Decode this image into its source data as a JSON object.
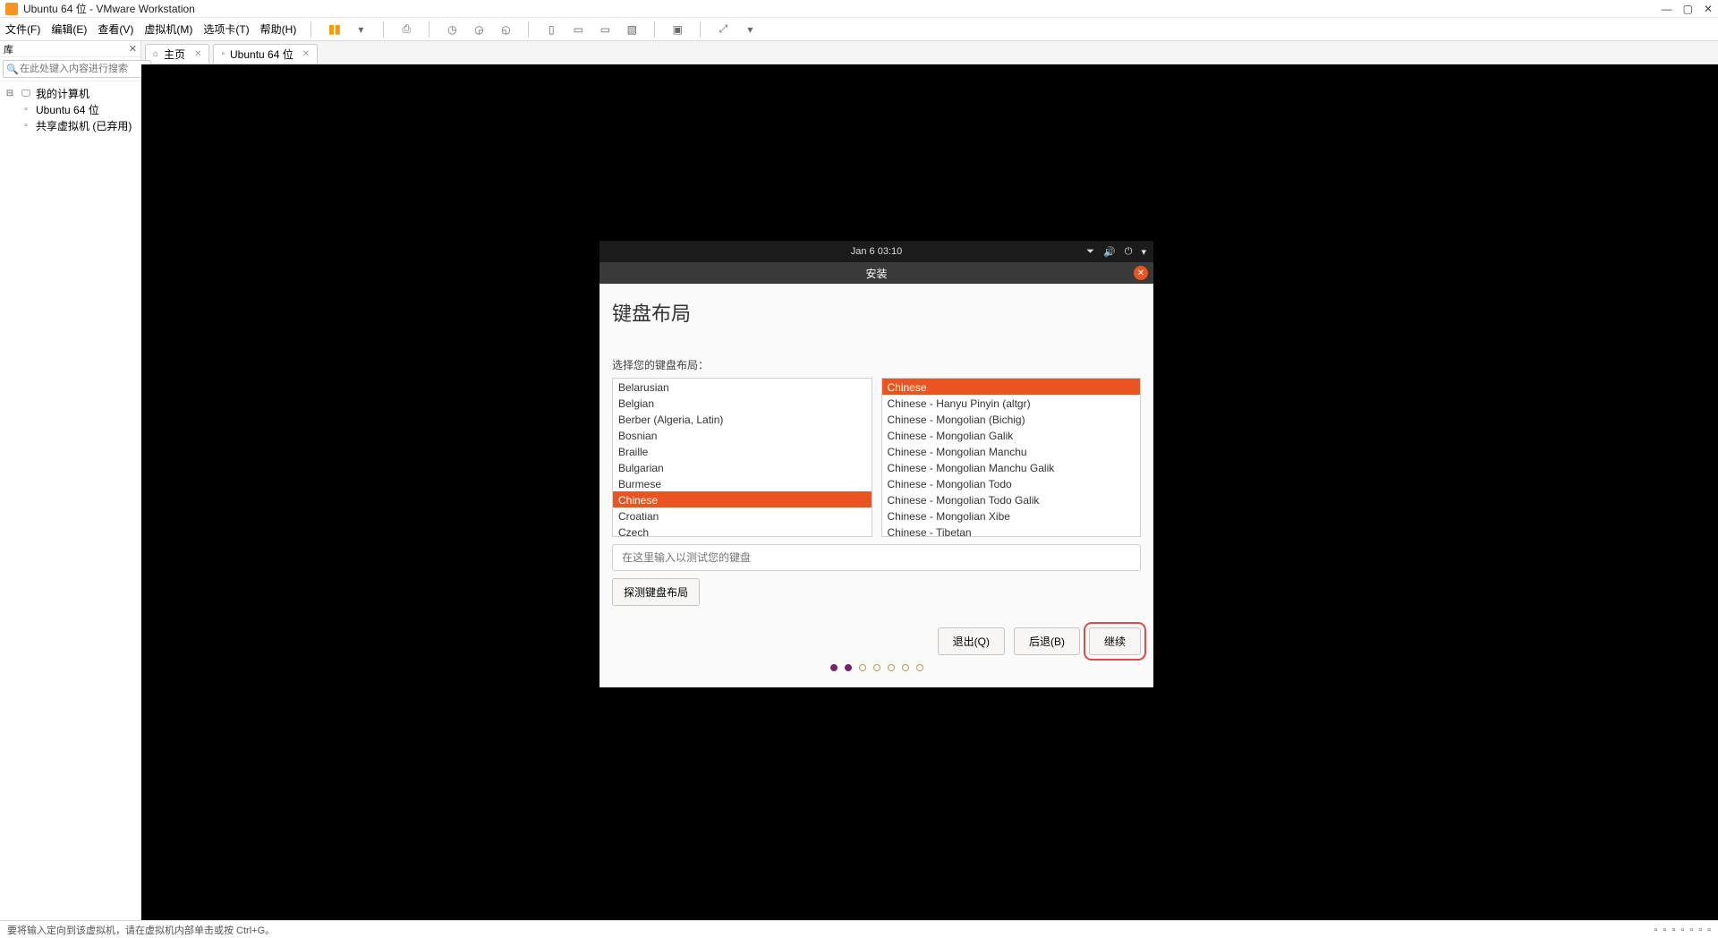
{
  "window": {
    "title": "Ubuntu 64 位 - VMware Workstation"
  },
  "menu": {
    "items": [
      "文件(F)",
      "编辑(E)",
      "查看(V)",
      "虚拟机(M)",
      "选项卡(T)",
      "帮助(H)"
    ]
  },
  "sidebar": {
    "title": "库",
    "search_placeholder": "在此处键入内容进行搜索",
    "tree": {
      "root": "我的计算机",
      "child1": "Ubuntu 64 位",
      "child2": "共享虚拟机 (已弃用)"
    }
  },
  "tabs": {
    "home": "主页",
    "vm": "Ubuntu 64 位"
  },
  "ubuntu": {
    "clock": "Jan 6  03:10",
    "installer_title": "安装",
    "heading": "键盘布局",
    "choose_label": "选择您的键盘布局：",
    "left_list": [
      "Belarusian",
      "Belgian",
      "Berber (Algeria, Latin)",
      "Bosnian",
      "Braille",
      "Bulgarian",
      "Burmese",
      "Chinese",
      "Croatian",
      "Czech"
    ],
    "left_selected_index": 7,
    "right_list": [
      "Chinese",
      "Chinese - Hanyu Pinyin (altgr)",
      "Chinese - Mongolian (Bichig)",
      "Chinese - Mongolian Galik",
      "Chinese - Mongolian Manchu",
      "Chinese - Mongolian Manchu Galik",
      "Chinese - Mongolian Todo",
      "Chinese - Mongolian Todo Galik",
      "Chinese - Mongolian Xibe",
      "Chinese - Tibetan"
    ],
    "right_selected_index": 0,
    "test_placeholder": "在这里输入以测试您的键盘",
    "detect_label": "探测键盘布局",
    "buttons": {
      "quit": "退出(Q)",
      "back": "后退(B)",
      "continue": "继续"
    }
  },
  "statusbar": {
    "text": "要将输入定向到该虚拟机，请在虚拟机内部单击或按 Ctrl+G。"
  }
}
